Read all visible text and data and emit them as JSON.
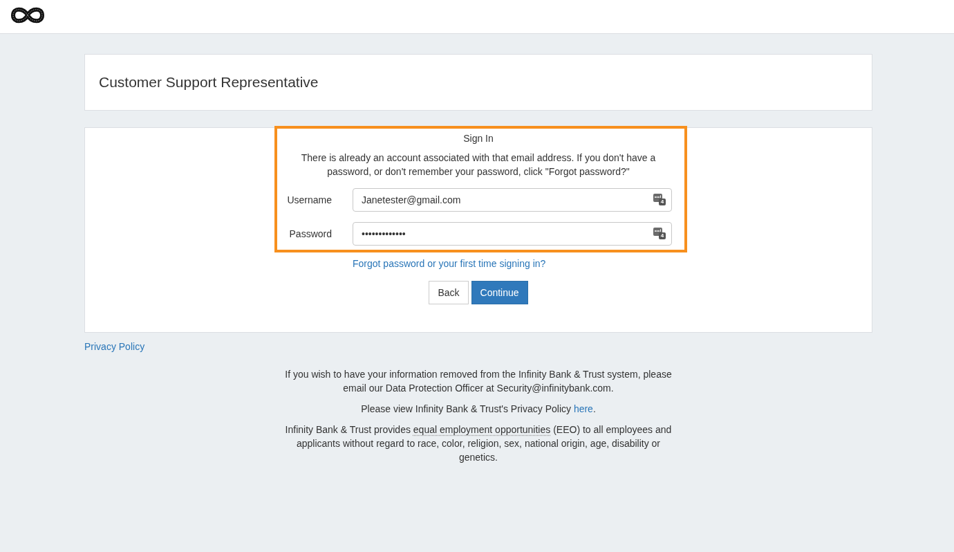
{
  "title_card": {
    "title": "Customer Support Representative"
  },
  "sign_in": {
    "highlighted": true,
    "heading": "Sign In",
    "message": "There is already an account associated with that email address. If you don't have a password, or don't remember your password, click \"Forgot password?\"",
    "fields": [
      {
        "label": "Username",
        "value": "Janetester@gmail.com",
        "badge": "4"
      },
      {
        "label": "Password",
        "value": "•••••••••••••",
        "badge": "4"
      }
    ],
    "forgot_link": "Forgot password or your first time signing in?",
    "buttons": [
      {
        "label": "Back",
        "kind": "secondary"
      },
      {
        "label": "Continue",
        "kind": "primary"
      }
    ]
  },
  "privacy_link": "Privacy Policy",
  "footer": {
    "paragraphs": [
      [
        {
          "kind": "text",
          "text": "If you wish to have your information removed from the Infinity Bank & Trust system, please email our Data Protection Officer at Security@infinitybank.com."
        }
      ],
      [
        {
          "kind": "text",
          "text": "Please view Infinity Bank & Trust's Privacy Policy "
        },
        {
          "kind": "link",
          "text": "here"
        },
        {
          "kind": "text",
          "text": "."
        }
      ],
      [
        {
          "kind": "text",
          "text": "Infinity Bank & Trust provides "
        },
        {
          "kind": "abbr",
          "text": "equal employment opportunities"
        },
        {
          "kind": "text",
          "text": " (EEO) to all employees and applicants without regard to race, color, religion, sex, national origin, age, disability or genetics."
        }
      ]
    ]
  }
}
